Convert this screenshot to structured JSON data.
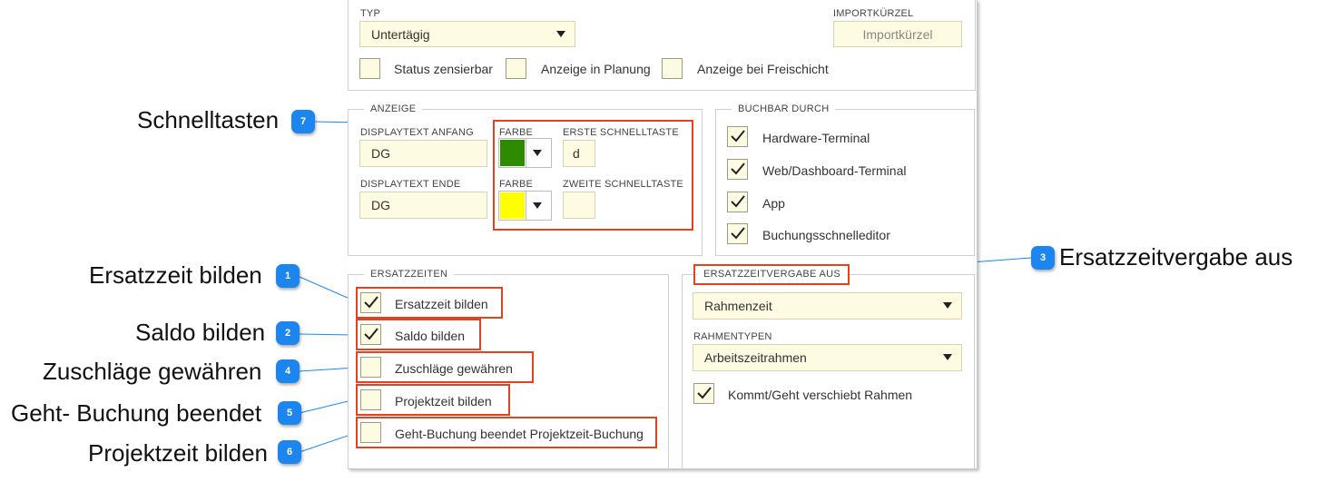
{
  "typ": {
    "label": "TYP",
    "value": "Untertägig"
  },
  "importkuerzel": {
    "label": "IMPORTKÜRZEL",
    "placeholder": "Importkürzel"
  },
  "top_checks": [
    {
      "label": "Status zensierbar",
      "checked": false
    },
    {
      "label": "Anzeige in Planung",
      "checked": false
    },
    {
      "label": "Anzeige bei Freischicht",
      "checked": false
    }
  ],
  "anzeige": {
    "legend": "ANZEIGE",
    "displaytext_anfang": {
      "label": "DISPLAYTEXT ANFANG",
      "value": "DG"
    },
    "displaytext_ende": {
      "label": "DISPLAYTEXT ENDE",
      "value": "DG"
    },
    "farbe1": {
      "label": "FARBE",
      "color": "#2e8b00"
    },
    "farbe2": {
      "label": "FARBE",
      "color": "#ffff00"
    },
    "erste_schnelltaste": {
      "label": "ERSTE SCHNELLTASTE",
      "value": "d"
    },
    "zweite_schnelltaste": {
      "label": "ZWEITE SCHNELLTASTE",
      "value": ""
    }
  },
  "buchbar": {
    "legend": "BUCHBAR DURCH",
    "items": [
      {
        "label": "Hardware-Terminal",
        "checked": true
      },
      {
        "label": "Web/Dashboard-Terminal",
        "checked": true
      },
      {
        "label": "App",
        "checked": true
      },
      {
        "label": "Buchungsschnelleditor",
        "checked": true
      }
    ]
  },
  "ersatzzeiten": {
    "legend": "ERSATZZEITEN",
    "items": [
      {
        "label": "Ersatzzeit bilden",
        "checked": true
      },
      {
        "label": "Saldo bilden",
        "checked": true
      },
      {
        "label": "Zuschläge gewähren",
        "checked": false
      },
      {
        "label": "Projektzeit bilden",
        "checked": false
      },
      {
        "label": "Geht-Buchung beendet Projektzeit-Buchung",
        "checked": false
      }
    ]
  },
  "ersatzzeitvergabe": {
    "legend": "ERSATZZEITVERGABE AUS",
    "value": "Rahmenzeit",
    "rahmentypen_label": "RAHMENTYPEN",
    "rahmentypen_value": "Arbeitszeitrahmen",
    "kommt_geht": {
      "label": "Kommt/Geht verschiebt Rahmen",
      "checked": true
    }
  },
  "callouts": [
    {
      "num": "7",
      "text": "Schnelltasten"
    },
    {
      "num": "1",
      "text": "Ersatzzeit bilden"
    },
    {
      "num": "2",
      "text": "Saldo bilden"
    },
    {
      "num": "4",
      "text": "Zuschläge gewähren"
    },
    {
      "num": "5",
      "text": "Geht- Buchung beendet"
    },
    {
      "num": "6",
      "text": "Projektzeit bilden"
    },
    {
      "num": "3",
      "text": "Ersatzzeitvergabe aus"
    }
  ],
  "colors": {
    "accent": "#1c86ee",
    "highlight": "#e0431f",
    "field_bg": "#fdfbe1"
  }
}
